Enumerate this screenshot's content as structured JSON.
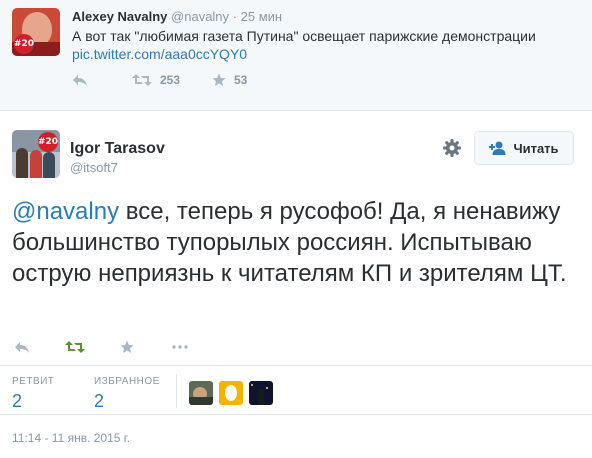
{
  "parent_tweet": {
    "name": "Alexey Navalny",
    "handle": "@navalny",
    "separator": "·",
    "time": "25 мин",
    "text": "А вот так \"любимая газета Путина\" освещает парижские демонстрации",
    "link": "pic.twitter.com/aaa0ccYQY0",
    "avatar_badge": "#20",
    "retweets": "253",
    "favorites": "53"
  },
  "main_tweet": {
    "name": "Igor Tarasov",
    "handle": "@itsoft7",
    "avatar_badge": "#20",
    "follow_label": "Читать",
    "mention": "@navalny",
    "text": " все, теперь я русофоб! Да, я ненавижу большинство тупорылых россиян. Испытываю острую неприязнь к читателям КП и зрителям ЦТ.",
    "stats": {
      "retweets_label": "РЕТВИТ",
      "retweets": "2",
      "favorites_label": "ИЗБРАННОЕ",
      "favorites": "2"
    },
    "timestamp": "11:14 - 11 янв. 2015 г."
  },
  "colors": {
    "link": "#2b7bb9",
    "retweet_active": "#5c913b",
    "muted": "#8899a6",
    "text": "#292f33",
    "badge": "#d0202b"
  },
  "icons": [
    "reply-icon",
    "retweet-icon",
    "favorite-icon",
    "more-icon",
    "gear-icon",
    "follow-icon"
  ]
}
